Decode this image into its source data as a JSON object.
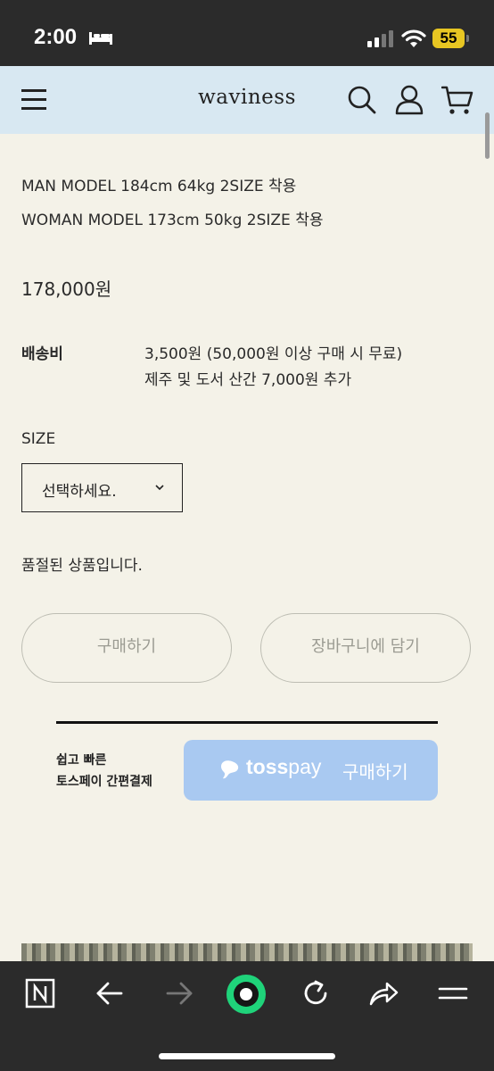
{
  "status_bar": {
    "time": "2:00",
    "battery": "55"
  },
  "header": {
    "logo": "waviness"
  },
  "product": {
    "model_lines": [
      "MAN MODEL 184cm 64kg 2SIZE 착용",
      "WOMAN MODEL 173cm 50kg 2SIZE 착용"
    ],
    "price": "178,000원",
    "shipping": {
      "label": "배송비",
      "lines": [
        "3,500원 (50,000원 이상 구매 시 무료)",
        "제주 및 도서 산간 7,000원 추가"
      ]
    },
    "size": {
      "label": "SIZE",
      "selected": "선택하세요."
    },
    "sold_out": "품절된 상품입니다.",
    "buy_button": "구매하기",
    "cart_button": "장바구니에 담기",
    "toss": {
      "note_lines": [
        "쉽고 빠른",
        "토스페이 간편결제"
      ],
      "brand": "toss",
      "brand_suffix": "pay",
      "button_label": "구매하기"
    }
  },
  "colors": {
    "background": "#f4f2e8",
    "header_bg": "#d8e8f2",
    "toss_blue": "#a9c9f1",
    "system_bar": "#2b2b2b",
    "battery": "#e8c622",
    "accent_green": "#1fd37a"
  },
  "icons": {
    "header": [
      "menu-icon",
      "search-icon",
      "user-icon",
      "cart-icon"
    ],
    "toolbar": [
      "naver-n-icon",
      "back-arrow-icon",
      "forward-arrow-icon",
      "green-home-icon",
      "reload-icon",
      "share-icon",
      "menu-lines-icon"
    ]
  }
}
